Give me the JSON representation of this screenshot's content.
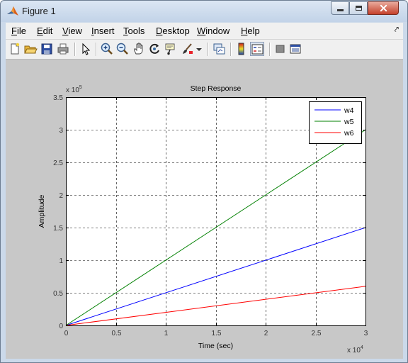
{
  "window": {
    "title": "Figure 1"
  },
  "menu": [
    {
      "key": "F",
      "rest": "ile"
    },
    {
      "key": "E",
      "rest": "dit"
    },
    {
      "key": "V",
      "rest": "iew"
    },
    {
      "key": "I",
      "rest": "nsert"
    },
    {
      "key": "T",
      "rest": "ools"
    },
    {
      "key": "D",
      "rest": "esktop"
    },
    {
      "key": "W",
      "rest": "indow"
    },
    {
      "key": "H",
      "rest": "elp"
    }
  ],
  "toolbar": {
    "icons": [
      "new-figure-icon",
      "open-file-icon",
      "save-icon",
      "print-icon",
      "edit-plot-arrow-icon",
      "zoom-in-icon",
      "zoom-out-icon",
      "pan-hand-icon",
      "rotate-3d-icon",
      "data-cursor-icon",
      "brush-icon",
      "link-plot-icon",
      "colorbar-icon",
      "legend-icon",
      "hide-plot-tools-icon",
      "show-plot-tools-icon"
    ]
  },
  "chart_data": {
    "type": "line",
    "title": "Step Response",
    "xlabel": "Time (sec)",
    "ylabel": "Amplitude",
    "xlim": [
      0,
      30000
    ],
    "ylim": [
      0,
      350000
    ],
    "x_multiplier_label": "x 10",
    "x_multiplier_exp": "4",
    "y_multiplier_label": "x 10",
    "y_multiplier_exp": "5",
    "xticks": [
      0,
      5000,
      10000,
      15000,
      20000,
      25000,
      30000
    ],
    "xtick_labels": [
      "0",
      "0.5",
      "1",
      "1.5",
      "2",
      "2.5",
      "3"
    ],
    "yticks": [
      0,
      50000,
      100000,
      150000,
      200000,
      250000,
      300000,
      350000
    ],
    "ytick_labels": [
      "0",
      "0.5",
      "1",
      "1.5",
      "2",
      "2.5",
      "3",
      "3.5"
    ],
    "grid": true,
    "legend_position": "top-right",
    "series": [
      {
        "name": "w4",
        "color": "#0000ff",
        "x": [
          0,
          30000
        ],
        "y": [
          0,
          150000
        ]
      },
      {
        "name": "w5",
        "color": "#008000",
        "x": [
          0,
          30000
        ],
        "y": [
          0,
          300000
        ]
      },
      {
        "name": "w6",
        "color": "#ff0000",
        "x": [
          0,
          30000
        ],
        "y": [
          0,
          60000
        ]
      }
    ]
  }
}
